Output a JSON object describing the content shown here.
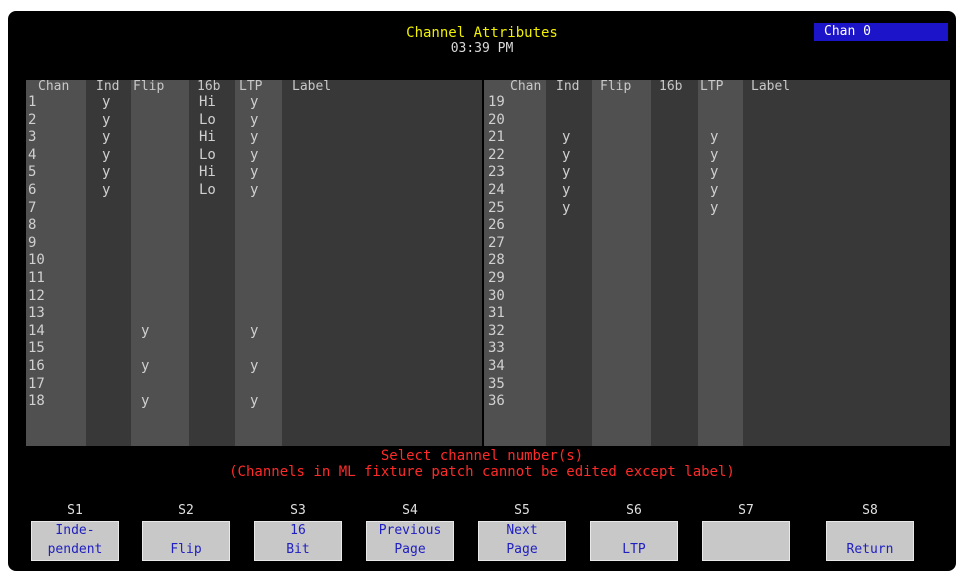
{
  "header": {
    "title": "Channel Attributes",
    "time": "03:39 PM",
    "channel_badge": "Chan 0"
  },
  "table_headers": [
    "Chan",
    "Ind",
    "Flip",
    "16b",
    "LTP",
    "Label"
  ],
  "left_rows": [
    {
      "chan": "1",
      "ind": "y",
      "flip": "",
      "b16": "Hi",
      "ltp": "y",
      "label": ""
    },
    {
      "chan": "2",
      "ind": "y",
      "flip": "",
      "b16": "Lo",
      "ltp": "y",
      "label": ""
    },
    {
      "chan": "3",
      "ind": "y",
      "flip": "",
      "b16": "Hi",
      "ltp": "y",
      "label": ""
    },
    {
      "chan": "4",
      "ind": "y",
      "flip": "",
      "b16": "Lo",
      "ltp": "y",
      "label": ""
    },
    {
      "chan": "5",
      "ind": "y",
      "flip": "",
      "b16": "Hi",
      "ltp": "y",
      "label": ""
    },
    {
      "chan": "6",
      "ind": "y",
      "flip": "",
      "b16": "Lo",
      "ltp": "y",
      "label": ""
    },
    {
      "chan": "7",
      "ind": "",
      "flip": "",
      "b16": "",
      "ltp": "",
      "label": ""
    },
    {
      "chan": "8",
      "ind": "",
      "flip": "",
      "b16": "",
      "ltp": "",
      "label": ""
    },
    {
      "chan": "9",
      "ind": "",
      "flip": "",
      "b16": "",
      "ltp": "",
      "label": ""
    },
    {
      "chan": "10",
      "ind": "",
      "flip": "",
      "b16": "",
      "ltp": "",
      "label": ""
    },
    {
      "chan": "11",
      "ind": "",
      "flip": "",
      "b16": "",
      "ltp": "",
      "label": ""
    },
    {
      "chan": "12",
      "ind": "",
      "flip": "",
      "b16": "",
      "ltp": "",
      "label": ""
    },
    {
      "chan": "13",
      "ind": "",
      "flip": "",
      "b16": "",
      "ltp": "",
      "label": ""
    },
    {
      "chan": "14",
      "ind": "",
      "flip": "y",
      "b16": "",
      "ltp": "y",
      "label": ""
    },
    {
      "chan": "15",
      "ind": "",
      "flip": "",
      "b16": "",
      "ltp": "",
      "label": ""
    },
    {
      "chan": "16",
      "ind": "",
      "flip": "y",
      "b16": "",
      "ltp": "y",
      "label": ""
    },
    {
      "chan": "17",
      "ind": "",
      "flip": "",
      "b16": "",
      "ltp": "",
      "label": ""
    },
    {
      "chan": "18",
      "ind": "",
      "flip": "y",
      "b16": "",
      "ltp": "y",
      "label": ""
    }
  ],
  "right_rows": [
    {
      "chan": "19",
      "ind": "",
      "flip": "",
      "b16": "",
      "ltp": "",
      "label": ""
    },
    {
      "chan": "20",
      "ind": "",
      "flip": "",
      "b16": "",
      "ltp": "",
      "label": ""
    },
    {
      "chan": "21",
      "ind": "y",
      "flip": "",
      "b16": "",
      "ltp": "y",
      "label": ""
    },
    {
      "chan": "22",
      "ind": "y",
      "flip": "",
      "b16": "",
      "ltp": "y",
      "label": ""
    },
    {
      "chan": "23",
      "ind": "y",
      "flip": "",
      "b16": "",
      "ltp": "y",
      "label": ""
    },
    {
      "chan": "24",
      "ind": "y",
      "flip": "",
      "b16": "",
      "ltp": "y",
      "label": ""
    },
    {
      "chan": "25",
      "ind": "y",
      "flip": "",
      "b16": "",
      "ltp": "y",
      "label": ""
    },
    {
      "chan": "26",
      "ind": "",
      "flip": "",
      "b16": "",
      "ltp": "",
      "label": ""
    },
    {
      "chan": "27",
      "ind": "",
      "flip": "",
      "b16": "",
      "ltp": "",
      "label": ""
    },
    {
      "chan": "28",
      "ind": "",
      "flip": "",
      "b16": "",
      "ltp": "",
      "label": ""
    },
    {
      "chan": "29",
      "ind": "",
      "flip": "",
      "b16": "",
      "ltp": "",
      "label": ""
    },
    {
      "chan": "30",
      "ind": "",
      "flip": "",
      "b16": "",
      "ltp": "",
      "label": ""
    },
    {
      "chan": "31",
      "ind": "",
      "flip": "",
      "b16": "",
      "ltp": "",
      "label": ""
    },
    {
      "chan": "32",
      "ind": "",
      "flip": "",
      "b16": "",
      "ltp": "",
      "label": ""
    },
    {
      "chan": "33",
      "ind": "",
      "flip": "",
      "b16": "",
      "ltp": "",
      "label": ""
    },
    {
      "chan": "34",
      "ind": "",
      "flip": "",
      "b16": "",
      "ltp": "",
      "label": ""
    },
    {
      "chan": "35",
      "ind": "",
      "flip": "",
      "b16": "",
      "ltp": "",
      "label": ""
    },
    {
      "chan": "36",
      "ind": "",
      "flip": "",
      "b16": "",
      "ltp": "",
      "label": ""
    }
  ],
  "messages": {
    "prompt": "Select channel number(s)",
    "note": "(Channels in ML fixture patch cannot be edited except label)"
  },
  "softkeys": [
    {
      "key": "S1",
      "line1": "Inde-",
      "line2": "pendent"
    },
    {
      "key": "S2",
      "line1": "",
      "line2": "Flip"
    },
    {
      "key": "S3",
      "line1": "16",
      "line2": "Bit"
    },
    {
      "key": "S4",
      "line1": "Previous",
      "line2": "Page"
    },
    {
      "key": "S5",
      "line1": "Next",
      "line2": "Page"
    },
    {
      "key": "S6",
      "line1": "",
      "line2": "LTP"
    },
    {
      "key": "S7",
      "line1": "",
      "line2": ""
    },
    {
      "key": "S8",
      "line1": "",
      "line2": "Return"
    }
  ]
}
